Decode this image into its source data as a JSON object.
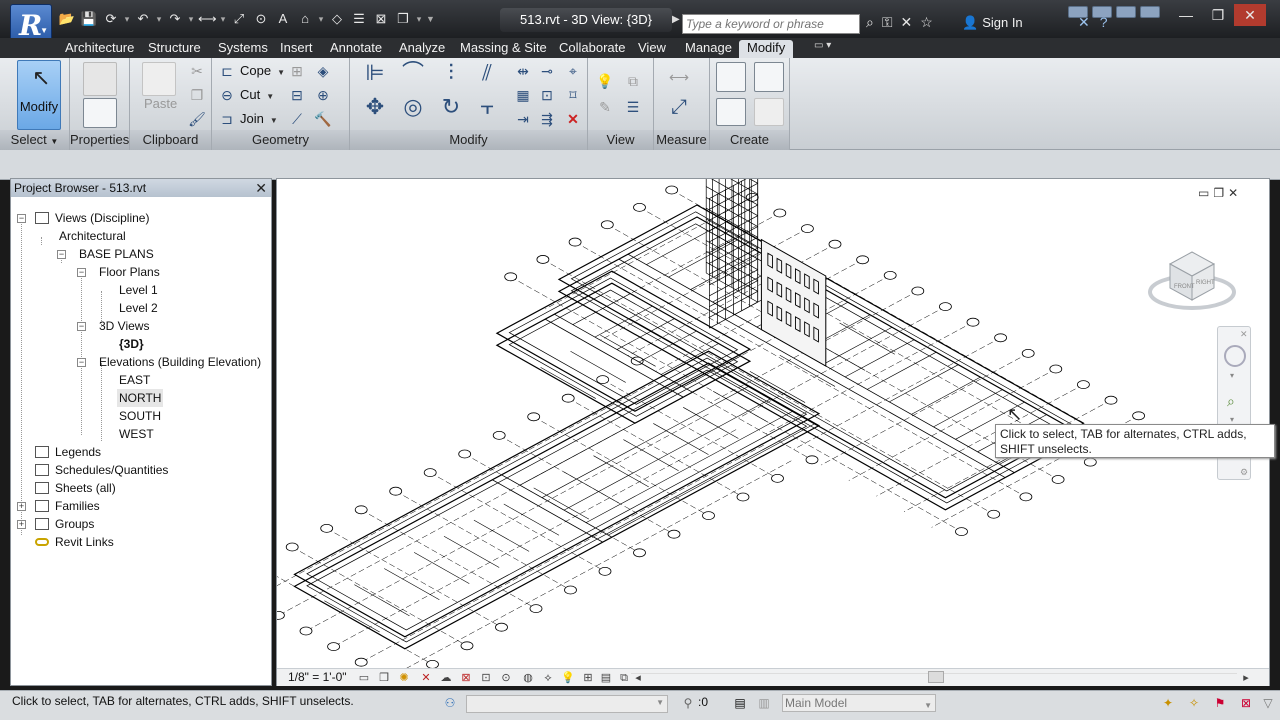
{
  "app": {
    "logo_letter": "R",
    "document_title": "513.rvt - 3D View: {3D}",
    "search_placeholder": "Type a keyword or phrase",
    "sign_in": "Sign In"
  },
  "ribbon_tabs": [
    "Architecture",
    "Structure",
    "Systems",
    "Insert",
    "Annotate",
    "Analyze",
    "Massing & Site",
    "Collaborate",
    "View",
    "Manage",
    "Modify"
  ],
  "active_tab": "Modify",
  "ribbon": {
    "modify_label": "Modify",
    "paste_label": "Paste",
    "cope_label": "Cope",
    "cut_label": "Cut",
    "join_label": "Join",
    "panels": {
      "select": "Select",
      "properties": "Properties",
      "clipboard": "Clipboard",
      "geometry": "Geometry",
      "modify": "Modify",
      "view": "View",
      "measure": "Measure",
      "create": "Create"
    }
  },
  "project_browser": {
    "title": "Project Browser - 513.rvt",
    "items": [
      {
        "label": "Views (Discipline)",
        "icon": "views-icon"
      },
      {
        "label": "Architectural"
      },
      {
        "label": "BASE PLANS"
      },
      {
        "label": "Floor Plans"
      },
      {
        "label": "Level 1"
      },
      {
        "label": "Level 2"
      },
      {
        "label": "3D Views"
      },
      {
        "label": "{3D}"
      },
      {
        "label": "Elevations (Building Elevation)"
      },
      {
        "label": "EAST"
      },
      {
        "label": "NORTH"
      },
      {
        "label": "SOUTH"
      },
      {
        "label": "WEST"
      },
      {
        "label": "Legends",
        "icon": "legends-icon"
      },
      {
        "label": "Schedules/Quantities",
        "icon": "schedules-icon"
      },
      {
        "label": "Sheets (all)",
        "icon": "sheets-icon"
      },
      {
        "label": "Families",
        "icon": "families-icon"
      },
      {
        "label": "Groups",
        "icon": "groups-icon"
      },
      {
        "label": "Revit Links",
        "icon": "revit-links-icon"
      }
    ]
  },
  "viewcube": {
    "front": "FRONT",
    "right": "RIGHT"
  },
  "tooltip": "Click to select, TAB for alternates, CTRL adds, SHIFT unselects.",
  "view_control": {
    "scale": "1/8\" = 1'-0\""
  },
  "status_bar": {
    "message": "Click to select, TAB for alternates, CTRL adds, SHIFT unselects.",
    "selection_count": ":0",
    "model_selector": "Main Model"
  }
}
